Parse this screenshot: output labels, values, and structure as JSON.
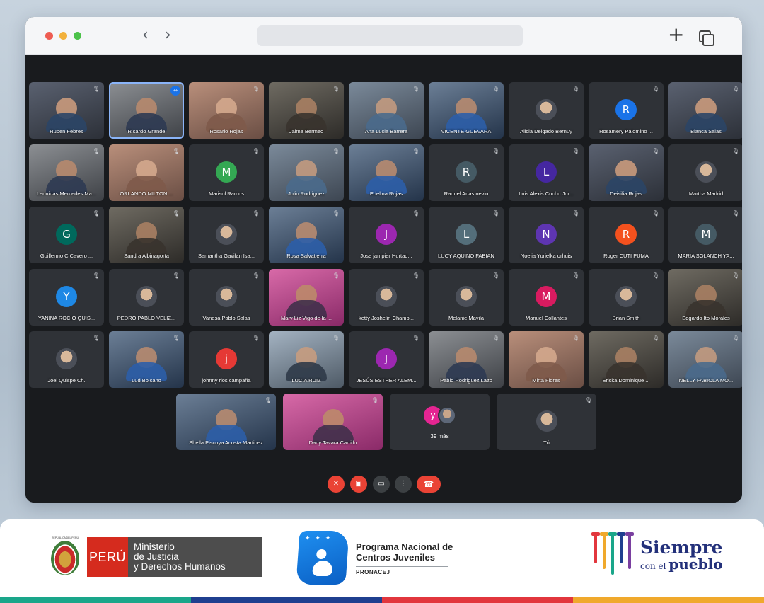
{
  "meeting": {
    "rows": [
      [
        {
          "name": "Ruben Febres",
          "kind": "video"
        },
        {
          "name": "Ricardo Grande",
          "kind": "video",
          "active": true
        },
        {
          "name": "Rosario Rojas",
          "kind": "video"
        },
        {
          "name": "Jaime Bermeo",
          "kind": "video"
        },
        {
          "name": "Ana Lucia Barrera",
          "kind": "video"
        },
        {
          "name": "VICENTE GUEVARA",
          "kind": "video"
        },
        {
          "name": "Alicia Delgado Bernuy",
          "kind": "photo"
        },
        {
          "name": "Rosamery Palomino ...",
          "kind": "letter",
          "letter": "R",
          "color": "#1a73e8"
        },
        {
          "name": "Bianca Salas",
          "kind": "video"
        }
      ],
      [
        {
          "name": "Leonidas Mercedes Ma...",
          "kind": "video"
        },
        {
          "name": "ORLANDO MILTON ...",
          "kind": "video"
        },
        {
          "name": "Marisol Ramos",
          "kind": "letter",
          "letter": "M",
          "color": "#34a853"
        },
        {
          "name": "Julio Rodriguez",
          "kind": "video"
        },
        {
          "name": "Edelina Rojas",
          "kind": "video"
        },
        {
          "name": "Raquel Arias nevio",
          "kind": "letter",
          "letter": "R",
          "color": "#455a64"
        },
        {
          "name": "Luis Alexis Cucho Jur...",
          "kind": "letter",
          "letter": "L",
          "color": "#4527a0"
        },
        {
          "name": "Deisilia Rojas",
          "kind": "video"
        },
        {
          "name": "Martha Madrid",
          "kind": "photo"
        }
      ],
      [
        {
          "name": "Guillermo C Cavero ...",
          "kind": "letter",
          "letter": "G",
          "color": "#00695c"
        },
        {
          "name": "Sandra Albinagorta",
          "kind": "video"
        },
        {
          "name": "Samantha Gavilan Isa...",
          "kind": "photo"
        },
        {
          "name": "Rosa Salvatierra",
          "kind": "video"
        },
        {
          "name": "Jose jampier Hurtad...",
          "kind": "letter",
          "letter": "J",
          "color": "#9c27b0"
        },
        {
          "name": "LUCY AQUINO FABIAN",
          "kind": "letter",
          "letter": "L",
          "color": "#546e7a"
        },
        {
          "name": "Noelia Yurielka orhuis",
          "kind": "letter",
          "letter": "N",
          "color": "#5e35b1"
        },
        {
          "name": "Roger CUTI PUMA",
          "kind": "letter",
          "letter": "R",
          "color": "#f4511e"
        },
        {
          "name": "MARIA SOLANCH YA...",
          "kind": "letter",
          "letter": "M",
          "color": "#455a64"
        }
      ],
      [
        {
          "name": "YANINA ROCIO QUIS...",
          "kind": "letter",
          "letter": "Y",
          "color": "#1e88e5"
        },
        {
          "name": "PEDRO PABLO VELIZ...",
          "kind": "photo"
        },
        {
          "name": "Vanesa Pablo Salas",
          "kind": "photo"
        },
        {
          "name": "Mary Liz Vigo de la ...",
          "kind": "video"
        },
        {
          "name": "ketty Joshelin Chamb...",
          "kind": "photo"
        },
        {
          "name": "Melanie Mavila",
          "kind": "photo"
        },
        {
          "name": "Manuel Collantes",
          "kind": "letter",
          "letter": "M",
          "color": "#d81b60"
        },
        {
          "name": "Brian Smith",
          "kind": "photo"
        },
        {
          "name": "Edgardo Ito Morales",
          "kind": "video"
        }
      ],
      [
        {
          "name": "Joel Quispe Ch.",
          "kind": "photo"
        },
        {
          "name": "Lud Boicano",
          "kind": "video"
        },
        {
          "name": "johnny rios campaña",
          "kind": "letter",
          "letter": "j",
          "color": "#e53935"
        },
        {
          "name": "LUCIA RUIZ",
          "kind": "video"
        },
        {
          "name": "JESÚS ESTHER ALEM...",
          "kind": "letter",
          "letter": "J",
          "color": "#9c27b0"
        },
        {
          "name": "Pablo Rodriguez Lazo",
          "kind": "video"
        },
        {
          "name": "Mirta Flores",
          "kind": "video"
        },
        {
          "name": "Ericka Dominique ...",
          "kind": "video"
        },
        {
          "name": "NELLY FABIOLA MO...",
          "kind": "video"
        }
      ]
    ],
    "bottom_row": [
      {
        "name": "Sheila Piscoya Acosta Martinez",
        "kind": "video"
      },
      {
        "name": "Dany Tavara Carrillo",
        "kind": "video"
      },
      {
        "name": "",
        "kind": "more",
        "letter": "y",
        "count_label": "39 más"
      },
      {
        "name": "Tú",
        "kind": "photo"
      }
    ]
  },
  "icons": {
    "mic_off": "🎙",
    "pin": "⇔"
  },
  "controls": {
    "mic_icon": "✕",
    "cam_icon": "▣",
    "present_icon": "▭",
    "more_icon": "⋮",
    "hangup_icon": "☎"
  },
  "browser": {
    "back": "‹",
    "forward": "›",
    "new_tab": "+"
  },
  "footer": {
    "peru": "PERÚ",
    "ministry_lines": [
      "Ministerio",
      "de Justicia",
      "y Derechos Humanos"
    ],
    "program_title_1": "Programa Nacional de",
    "program_title_2": "Centros Juveniles",
    "program_short": "PRONACEJ",
    "slogan_1": "Siempre",
    "slogan_2a": "con el",
    "slogan_2b": "pueblo",
    "crest_caption": "REPÚBLICA DEL PERÚ",
    "stripe_colors": [
      "#1aa68a",
      "#1f3f8f",
      "#e2363d",
      "#f0a92c"
    ],
    "siempre_colors": [
      "#e2363d",
      "#f0a92c",
      "#1aa68a",
      "#1f3f8f",
      "#7a3fa0"
    ]
  }
}
